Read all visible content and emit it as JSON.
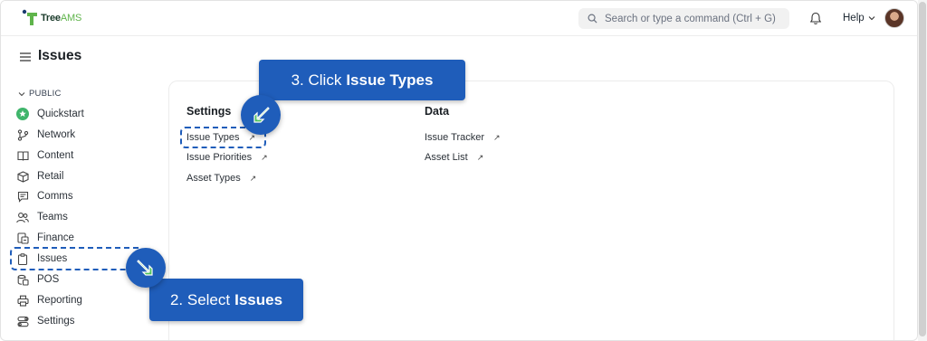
{
  "app": {
    "logo_tree": "Tree",
    "logo_ams": "AMS"
  },
  "search": {
    "placeholder": "Search or type a command (Ctrl + G)"
  },
  "header": {
    "help_label": "Help"
  },
  "page": {
    "title": "Issues"
  },
  "sidebar": {
    "section_label": "PUBLIC",
    "items": [
      {
        "label": "Quickstart",
        "icon": "quickstart-icon"
      },
      {
        "label": "Network",
        "icon": "network-icon"
      },
      {
        "label": "Content",
        "icon": "content-icon"
      },
      {
        "label": "Retail",
        "icon": "retail-icon"
      },
      {
        "label": "Comms",
        "icon": "comms-icon"
      },
      {
        "label": "Teams",
        "icon": "teams-icon"
      },
      {
        "label": "Finance",
        "icon": "finance-icon"
      },
      {
        "label": "Issues",
        "icon": "clipboard-icon"
      },
      {
        "label": "POS",
        "icon": "pos-icon"
      },
      {
        "label": "Reporting",
        "icon": "printer-icon"
      },
      {
        "label": "Settings",
        "icon": "settings-icon"
      }
    ]
  },
  "main": {
    "settings": {
      "title": "Settings",
      "links": [
        "Issue Types",
        "Issue Priorities",
        "Asset Types"
      ]
    },
    "data": {
      "title": "Data",
      "links": [
        "Issue Tracker",
        "Asset List"
      ]
    }
  },
  "callouts": {
    "step3_prefix": "3. Click",
    "step3_bold": "Issue Types",
    "step2_prefix": "2. Select",
    "step2_bold": "Issues"
  },
  "colors": {
    "callout": "#1f5dba",
    "pointer_arrow": "#4cc25a",
    "quickstart_green": "#3fb56b"
  }
}
